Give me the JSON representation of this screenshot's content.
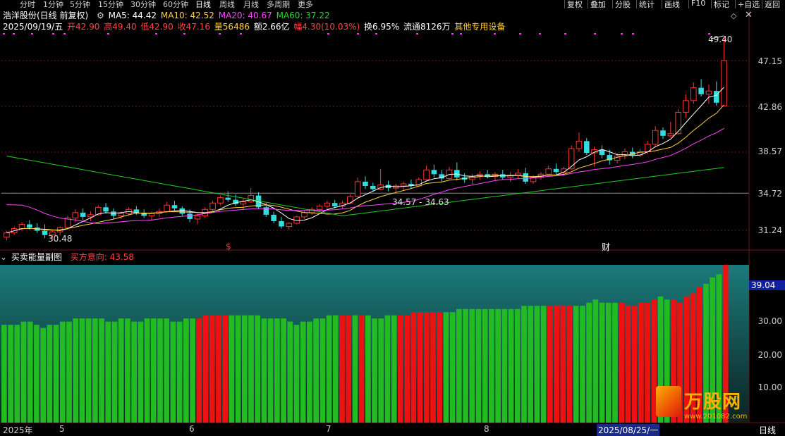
{
  "toolbar": {
    "items": [
      "分时",
      "1分钟",
      "5分钟",
      "15分钟",
      "30分钟",
      "60分钟",
      "日线",
      "周线",
      "月线",
      "多周期",
      "更多"
    ],
    "active": "日线",
    "right_items": [
      "复权",
      "叠加",
      "分股",
      "统计",
      "画线",
      "F10",
      "标记",
      "+自选",
      "返回"
    ]
  },
  "stock": {
    "title": "浩洋股份(日线 前复权)",
    "ma5_label": "MA5: 44.42",
    "ma10_label": "MA10: 42.52",
    "ma20_label": "MA20: 40.67",
    "ma60_label": "MA60: 37.22",
    "date": "2025/09/19/五",
    "open": "开42.90",
    "high": "高49.40",
    "low": "低42.90",
    "close": "收47.16",
    "volume": "量56486",
    "amount": "额2.66亿",
    "change": "幅4.30(10.03%)",
    "turnover": "换6.95%",
    "float": "流通8126万",
    "sector": "其他专用设备"
  },
  "colors": {
    "up": "#ff3333",
    "down": "#33dddd",
    "ma5": "#ffffff",
    "ma10": "#ffd040",
    "ma20": "#ff44ff",
    "ma60": "#22cc22",
    "ind_red": "#ee1111",
    "ind_green": "#22bb22"
  },
  "price_axis": [
    "47.15",
    "42.86",
    "38.57",
    "34.72",
    "31.24"
  ],
  "annotations": {
    "high_label": "49.40",
    "low_label": "30.48",
    "mid_label": "34.57 - 34.63",
    "marker_s": "$",
    "marker_cai": "财"
  },
  "indicator": {
    "title": "买卖能量副图",
    "value_label": "买方意向: 43.58",
    "current_value": "39.04",
    "axis": [
      "30.00",
      "20.00",
      "10.00"
    ]
  },
  "date_axis": [
    "2025年",
    "5",
    "6",
    "7",
    "8",
    "2025/08/25/一",
    "日线"
  ],
  "chart_data": {
    "type": "candlestick",
    "title": "浩洋股份(日线 前复权)",
    "candles": [
      {
        "o": 30.6,
        "h": 31.2,
        "l": 30.3,
        "c": 31.0
      },
      {
        "o": 31.0,
        "h": 31.6,
        "l": 30.8,
        "c": 31.4
      },
      {
        "o": 31.4,
        "h": 32.0,
        "l": 31.2,
        "c": 31.8
      },
      {
        "o": 31.8,
        "h": 32.2,
        "l": 31.3,
        "c": 31.5
      },
      {
        "o": 31.5,
        "h": 31.9,
        "l": 31.0,
        "c": 31.2
      },
      {
        "o": 31.2,
        "h": 31.8,
        "l": 30.5,
        "c": 30.8
      },
      {
        "o": 30.8,
        "h": 31.2,
        "l": 30.48,
        "c": 31.1
      },
      {
        "o": 31.1,
        "h": 31.6,
        "l": 30.8,
        "c": 31.5
      },
      {
        "o": 31.5,
        "h": 32.6,
        "l": 31.3,
        "c": 32.4
      },
      {
        "o": 32.4,
        "h": 33.2,
        "l": 32.0,
        "c": 32.9
      },
      {
        "o": 32.9,
        "h": 33.3,
        "l": 32.2,
        "c": 32.5
      },
      {
        "o": 32.5,
        "h": 33.0,
        "l": 32.1,
        "c": 32.7
      },
      {
        "o": 32.7,
        "h": 33.6,
        "l": 32.6,
        "c": 33.4
      },
      {
        "o": 33.4,
        "h": 33.8,
        "l": 32.8,
        "c": 33.0
      },
      {
        "o": 33.0,
        "h": 33.3,
        "l": 32.3,
        "c": 32.6
      },
      {
        "o": 32.6,
        "h": 33.0,
        "l": 32.3,
        "c": 32.8
      },
      {
        "o": 32.8,
        "h": 33.4,
        "l": 32.6,
        "c": 33.2
      },
      {
        "o": 33.2,
        "h": 33.5,
        "l": 32.7,
        "c": 32.9
      },
      {
        "o": 32.9,
        "h": 33.2,
        "l": 32.4,
        "c": 32.6
      },
      {
        "o": 32.6,
        "h": 33.0,
        "l": 32.2,
        "c": 32.8
      },
      {
        "o": 32.8,
        "h": 33.3,
        "l": 32.5,
        "c": 33.0
      },
      {
        "o": 33.0,
        "h": 33.9,
        "l": 32.9,
        "c": 33.6
      },
      {
        "o": 33.6,
        "h": 34.0,
        "l": 33.1,
        "c": 33.3
      },
      {
        "o": 33.3,
        "h": 33.5,
        "l": 32.6,
        "c": 32.8
      },
      {
        "o": 32.8,
        "h": 33.2,
        "l": 32.0,
        "c": 32.3
      },
      {
        "o": 32.3,
        "h": 32.8,
        "l": 31.8,
        "c": 32.6
      },
      {
        "o": 32.6,
        "h": 33.4,
        "l": 32.4,
        "c": 33.2
      },
      {
        "o": 33.2,
        "h": 34.0,
        "l": 33.0,
        "c": 33.8
      },
      {
        "o": 33.8,
        "h": 34.5,
        "l": 33.6,
        "c": 34.3
      },
      {
        "o": 34.3,
        "h": 34.9,
        "l": 33.9,
        "c": 34.1
      },
      {
        "o": 34.1,
        "h": 34.6,
        "l": 33.5,
        "c": 33.7
      },
      {
        "o": 33.7,
        "h": 34.2,
        "l": 33.2,
        "c": 33.9
      },
      {
        "o": 33.9,
        "h": 35.2,
        "l": 33.8,
        "c": 34.5
      },
      {
        "o": 34.5,
        "h": 34.8,
        "l": 33.2,
        "c": 33.4
      },
      {
        "o": 33.4,
        "h": 33.8,
        "l": 32.5,
        "c": 32.7
      },
      {
        "o": 32.7,
        "h": 33.0,
        "l": 31.9,
        "c": 32.1
      },
      {
        "o": 32.1,
        "h": 32.5,
        "l": 31.4,
        "c": 31.6
      },
      {
        "o": 31.6,
        "h": 32.0,
        "l": 31.3,
        "c": 31.9
      },
      {
        "o": 31.9,
        "h": 32.6,
        "l": 31.8,
        "c": 32.5
      },
      {
        "o": 32.5,
        "h": 33.1,
        "l": 32.3,
        "c": 32.9
      },
      {
        "o": 32.9,
        "h": 33.4,
        "l": 32.7,
        "c": 33.2
      },
      {
        "o": 33.2,
        "h": 33.7,
        "l": 33.0,
        "c": 33.5
      },
      {
        "o": 33.5,
        "h": 34.0,
        "l": 33.2,
        "c": 33.8
      },
      {
        "o": 33.8,
        "h": 34.1,
        "l": 33.3,
        "c": 33.5
      },
      {
        "o": 33.5,
        "h": 34.0,
        "l": 33.3,
        "c": 33.8
      },
      {
        "o": 33.8,
        "h": 34.6,
        "l": 33.7,
        "c": 34.4
      },
      {
        "o": 34.4,
        "h": 36.2,
        "l": 34.3,
        "c": 35.8
      },
      {
        "o": 35.8,
        "h": 36.3,
        "l": 35.1,
        "c": 35.4
      },
      {
        "o": 35.4,
        "h": 35.7,
        "l": 34.9,
        "c": 35.1
      },
      {
        "o": 35.1,
        "h": 37.0,
        "l": 35.0,
        "c": 35.5
      },
      {
        "o": 35.5,
        "h": 35.9,
        "l": 34.9,
        "c": 35.2
      },
      {
        "o": 35.2,
        "h": 35.6,
        "l": 34.8,
        "c": 35.4
      },
      {
        "o": 35.4,
        "h": 35.8,
        "l": 35.0,
        "c": 35.6
      },
      {
        "o": 35.6,
        "h": 36.0,
        "l": 35.2,
        "c": 35.4
      },
      {
        "o": 35.4,
        "h": 36.2,
        "l": 35.3,
        "c": 36.0
      },
      {
        "o": 36.0,
        "h": 37.3,
        "l": 35.9,
        "c": 36.9
      },
      {
        "o": 36.9,
        "h": 37.4,
        "l": 36.2,
        "c": 36.5
      },
      {
        "o": 36.5,
        "h": 36.9,
        "l": 35.8,
        "c": 36.1
      },
      {
        "o": 36.1,
        "h": 37.2,
        "l": 36.0,
        "c": 36.9
      },
      {
        "o": 36.9,
        "h": 37.6,
        "l": 35.9,
        "c": 36.2
      },
      {
        "o": 36.2,
        "h": 36.6,
        "l": 35.7,
        "c": 36.0
      },
      {
        "o": 36.0,
        "h": 36.5,
        "l": 35.6,
        "c": 36.3
      },
      {
        "o": 36.3,
        "h": 36.8,
        "l": 36.0,
        "c": 36.5
      },
      {
        "o": 36.5,
        "h": 36.9,
        "l": 36.1,
        "c": 36.3
      },
      {
        "o": 36.3,
        "h": 36.7,
        "l": 35.9,
        "c": 36.5
      },
      {
        "o": 36.5,
        "h": 36.9,
        "l": 36.0,
        "c": 36.2
      },
      {
        "o": 36.2,
        "h": 36.7,
        "l": 35.8,
        "c": 36.4
      },
      {
        "o": 36.4,
        "h": 37.0,
        "l": 36.1,
        "c": 36.6
      },
      {
        "o": 36.6,
        "h": 37.1,
        "l": 35.6,
        "c": 35.8
      },
      {
        "o": 35.8,
        "h": 36.4,
        "l": 35.6,
        "c": 36.2
      },
      {
        "o": 36.2,
        "h": 36.7,
        "l": 36.0,
        "c": 36.5
      },
      {
        "o": 36.5,
        "h": 37.3,
        "l": 36.4,
        "c": 37.0
      },
      {
        "o": 37.0,
        "h": 37.5,
        "l": 36.5,
        "c": 36.7
      },
      {
        "o": 36.7,
        "h": 37.2,
        "l": 36.4,
        "c": 37.0
      },
      {
        "o": 37.0,
        "h": 39.2,
        "l": 36.9,
        "c": 38.9
      },
      {
        "o": 38.9,
        "h": 40.4,
        "l": 38.6,
        "c": 39.6
      },
      {
        "o": 39.6,
        "h": 39.9,
        "l": 38.3,
        "c": 38.5
      },
      {
        "o": 38.5,
        "h": 39.1,
        "l": 37.2,
        "c": 38.8
      },
      {
        "o": 38.8,
        "h": 39.2,
        "l": 38.0,
        "c": 38.3
      },
      {
        "o": 38.3,
        "h": 38.8,
        "l": 37.4,
        "c": 37.8
      },
      {
        "o": 37.8,
        "h": 38.5,
        "l": 37.5,
        "c": 38.2
      },
      {
        "o": 38.2,
        "h": 38.9,
        "l": 37.9,
        "c": 38.6
      },
      {
        "o": 38.6,
        "h": 39.0,
        "l": 38.0,
        "c": 38.3
      },
      {
        "o": 38.3,
        "h": 38.9,
        "l": 38.1,
        "c": 38.6
      },
      {
        "o": 38.6,
        "h": 39.6,
        "l": 38.4,
        "c": 39.3
      },
      {
        "o": 39.3,
        "h": 41.0,
        "l": 39.1,
        "c": 40.6
      },
      {
        "o": 40.6,
        "h": 40.9,
        "l": 39.8,
        "c": 40.1
      },
      {
        "o": 40.1,
        "h": 41.4,
        "l": 39.9,
        "c": 40.3
      },
      {
        "o": 40.3,
        "h": 42.6,
        "l": 40.2,
        "c": 42.3
      },
      {
        "o": 42.3,
        "h": 44.0,
        "l": 41.8,
        "c": 43.4
      },
      {
        "o": 43.4,
        "h": 45.1,
        "l": 43.1,
        "c": 44.6
      },
      {
        "o": 44.6,
        "h": 45.4,
        "l": 43.8,
        "c": 44.0
      },
      {
        "o": 44.0,
        "h": 44.9,
        "l": 43.1,
        "c": 44.3
      },
      {
        "o": 44.3,
        "h": 45.2,
        "l": 42.9,
        "c": 43.2
      },
      {
        "o": 42.9,
        "h": 49.4,
        "l": 42.9,
        "c": 47.16
      }
    ],
    "ma": {
      "MA5": 44.42,
      "MA10": 42.52,
      "MA20": 40.67,
      "MA60": 37.22
    },
    "ylim": [
      30.0,
      50.0
    ],
    "indicator_series": [
      31,
      31,
      31,
      32,
      32,
      31,
      30,
      31,
      31,
      32,
      32,
      33,
      33,
      33,
      33,
      33,
      32,
      32,
      33,
      33,
      32,
      32,
      33,
      33,
      33,
      33,
      32,
      32,
      33,
      33,
      33,
      34,
      34,
      34,
      34,
      34,
      34,
      34,
      34,
      34,
      33,
      33,
      33,
      33,
      32,
      31,
      32,
      32,
      33,
      33,
      34,
      34,
      34,
      34,
      34,
      34,
      34,
      33,
      33,
      34,
      34,
      34,
      34,
      35,
      35,
      35,
      35,
      35,
      35,
      35,
      36,
      36,
      36,
      36,
      36,
      36,
      36,
      36,
      36,
      36,
      37,
      37,
      37,
      37,
      37,
      37,
      37,
      37,
      37,
      37,
      38,
      39,
      38,
      38,
      38,
      38,
      37,
      37,
      38,
      38,
      39,
      40,
      39,
      39,
      38,
      40,
      41,
      43,
      44,
      46,
      47,
      50
    ]
  }
}
